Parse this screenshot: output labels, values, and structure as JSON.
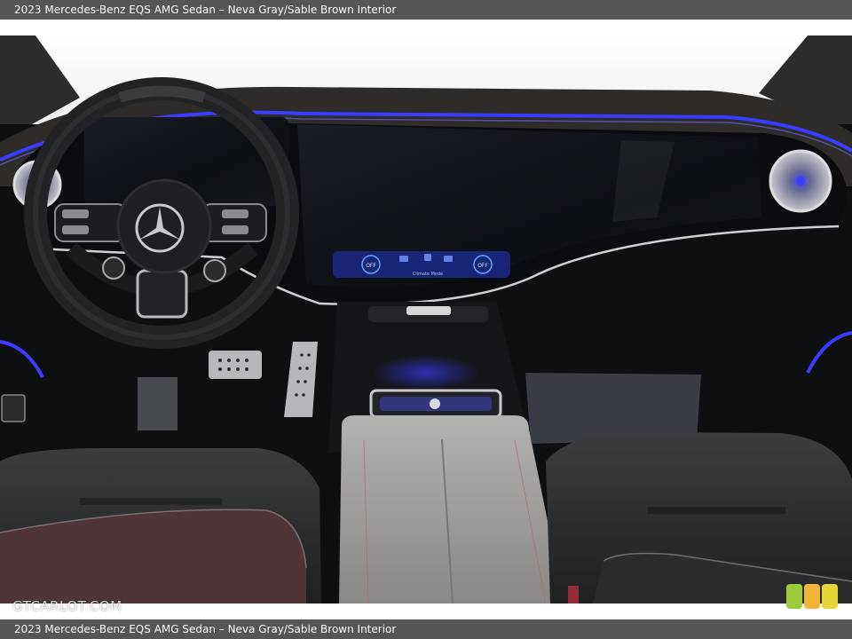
{
  "caption": {
    "top_text": "2023 Mercedes-Benz EQS AMG Sedan – Neva Gray/Sable Brown Interior",
    "bottom_text": "2023 Mercedes-Benz EQS AMG Sedan – Neva Gray/Sable Brown Interior"
  },
  "watermark": {
    "text": "GTCARLOT.COM"
  },
  "photo": {
    "subject": "interior-dashboard",
    "colors": {
      "ambient_light": "#3a3cff",
      "dashboard": "#121416",
      "trim": "#c9c9cc",
      "seat": "#2b2d2f",
      "console": "#9c9a98",
      "seat_bolster": "#5a3a3e",
      "windshield": "#f6f6f6"
    },
    "screen_labels": {
      "left_button": "OFF",
      "right_button": "OFF",
      "status": "Climate Mode"
    }
  },
  "logo": {
    "colors": [
      "#9ccc3c",
      "#f2b537",
      "#e8d53a"
    ]
  }
}
